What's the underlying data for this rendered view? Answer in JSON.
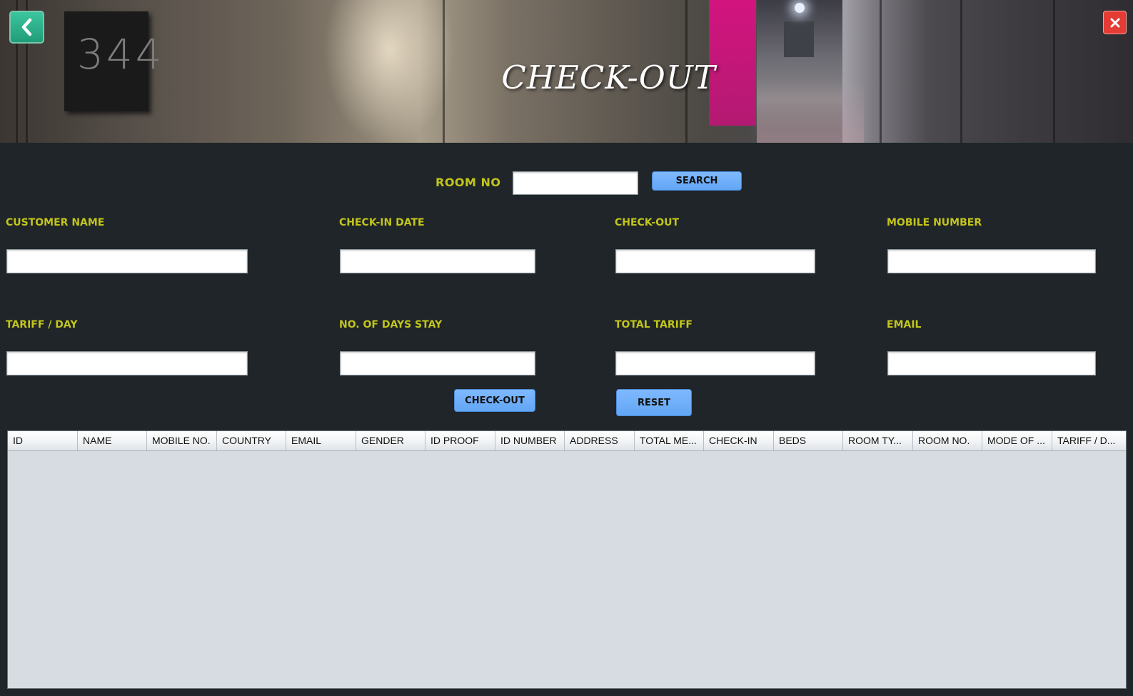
{
  "header": {
    "title": "CHECK-OUT",
    "door_number": "344",
    "back_icon": "chevron-left-icon",
    "close_icon": "close-icon",
    "colors": {
      "back": "#2bb58d",
      "close": "#e53b35"
    }
  },
  "search": {
    "room_no_label": "ROOM NO",
    "room_no_value": "",
    "search_button": "SEARCH"
  },
  "form": {
    "customer_name_label": "CUSTOMER NAME",
    "checkin_date_label": "CHECK-IN DATE",
    "checkout_label": "CHECK-OUT",
    "mobile_number_label": "MOBILE NUMBER",
    "tariff_day_label": "TARIFF / DAY",
    "days_stay_label": "NO. OF DAYS STAY",
    "total_tariff_label": "TOTAL TARIFF",
    "email_label": "EMAIL",
    "label_color": "#c3c51c"
  },
  "actions": {
    "checkout_button": "CHECK-OUT",
    "reset_button": "RESET",
    "button_color": "#6faef9"
  },
  "table": {
    "columns": [
      "ID",
      "NAME",
      "MOBILE NO.",
      "COUNTRY",
      "EMAIL",
      "GENDER",
      "ID PROOF",
      "ID NUMBER",
      "ADDRESS",
      "TOTAL ME...",
      "CHECK-IN",
      "BEDS",
      "ROOM TY...",
      "ROOM NO.",
      "MODE OF ...",
      "TARIFF / D..."
    ],
    "rows": []
  }
}
